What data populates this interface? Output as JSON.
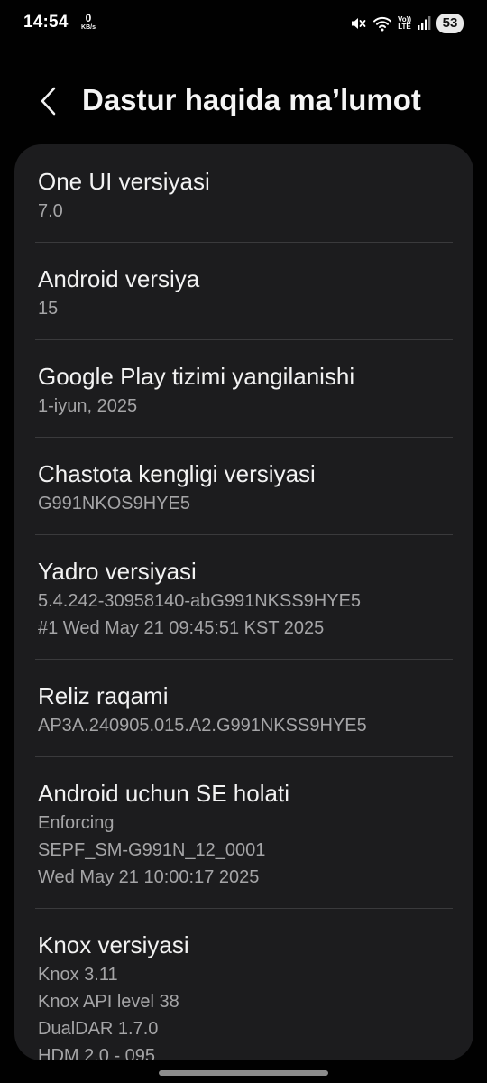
{
  "status_bar": {
    "time": "14:54",
    "net_speed_value": "0",
    "net_speed_unit": "KB/s",
    "volte_label_top": "Vo))",
    "volte_label_bottom": "LTE",
    "battery_level": "53",
    "icons": [
      "mute-icon",
      "wifi-icon",
      "volte-icon",
      "signal-icon",
      "battery-icon"
    ]
  },
  "header": {
    "back_icon": "chevron-left-icon",
    "title": "Dastur haqida ma’lumot"
  },
  "items": [
    {
      "title": "One UI versiyasi",
      "values": [
        "7.0"
      ]
    },
    {
      "title": "Android versiya",
      "values": [
        "15"
      ]
    },
    {
      "title": "Google Play tizimi yangilanishi",
      "values": [
        "1-iyun, 2025"
      ]
    },
    {
      "title": "Chastota kengligi versiyasi",
      "values": [
        "G991NKOS9HYE5"
      ]
    },
    {
      "title": "Yadro versiyasi",
      "values": [
        "5.4.242-30958140-abG991NKSS9HYE5",
        "#1 Wed May 21 09:45:51 KST 2025"
      ]
    },
    {
      "title": "Reliz raqami",
      "values": [
        "AP3A.240905.015.A2.G991NKSS9HYE5"
      ]
    },
    {
      "title": "Android uchun SE holati",
      "values": [
        "Enforcing",
        "SEPF_SM-G991N_12_0001",
        "Wed May 21 10:00:17 2025"
      ]
    },
    {
      "title": "Knox versiyasi",
      "values": [
        "Knox 3.11",
        "Knox API level 38",
        "DualDAR 1.7.0",
        "HDM 2.0 - 095"
      ]
    }
  ],
  "colors": {
    "background": "#010101",
    "card": "#1c1c1e",
    "primary_text": "#f2f2f2",
    "secondary_text": "#a5a5a7",
    "divider": "#3a3a3c"
  }
}
